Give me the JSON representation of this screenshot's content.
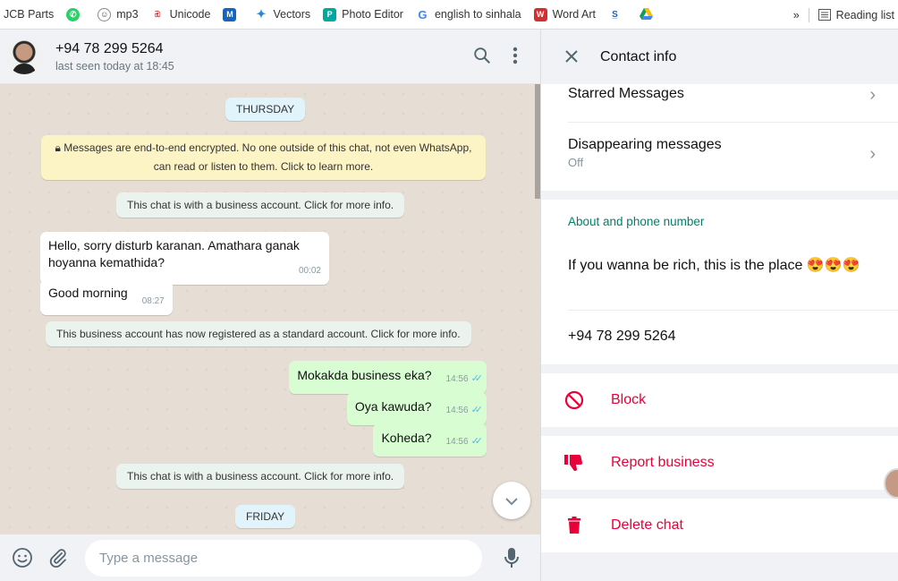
{
  "bookmarks": {
    "items": [
      {
        "label": "JCB Parts"
      },
      {
        "label": ""
      },
      {
        "label": "mp3"
      },
      {
        "label": "Unicode"
      },
      {
        "label": ""
      },
      {
        "label": "Vectors"
      },
      {
        "label": "Photo Editor"
      },
      {
        "label": "english to sinhala"
      },
      {
        "label": "Word Art"
      },
      {
        "label": ""
      },
      {
        "label": ""
      }
    ],
    "more": "»",
    "reading_list": "Reading list"
  },
  "chat": {
    "contact_name": "+94 78 299 5264",
    "last_seen": "last seen today at 18:45",
    "messages": {
      "day1": "THURSDAY",
      "encryption": "Messages are end-to-end encrypted. No one outside of this chat, not even WhatsApp, can read or listen to them. Click to learn more.",
      "business_notice_1": "This chat is with a business account. Click for more info.",
      "in1_text": "Hello, sorry disturb karanan. Amathara ganak hoyanna kemathida?",
      "in1_time": "00:02",
      "in2_text": "Good morning",
      "in2_time": "08:27",
      "standard_notice": "This business account has now registered as a standard account. Click for more info.",
      "out1_text": "Mokakda business eka?",
      "out1_time": "14:56",
      "out2_text": "Oya kawuda?",
      "out2_time": "14:56",
      "out3_text": "Koheda?",
      "out3_time": "14:56",
      "business_notice_2": "This chat is with a business account. Click for more info.",
      "day2": "FRIDAY"
    },
    "composer": {
      "placeholder": "Type a message"
    }
  },
  "contact_info": {
    "title": "Contact info",
    "starred": "Starred Messages",
    "disappearing": "Disappearing messages",
    "disappearing_value": "Off",
    "about_title": "About and phone number",
    "about_text": "If you wanna be rich, this is the place 😍😍😍",
    "phone": "+94 78 299 5264",
    "block": "Block",
    "report": "Report business",
    "delete": "Delete chat"
  },
  "colors": {
    "accent_green": "#008069",
    "danger_red": "#ea0038",
    "outgoing_bubble": "#d9fdd3",
    "read_ticks": "#53bdeb"
  }
}
